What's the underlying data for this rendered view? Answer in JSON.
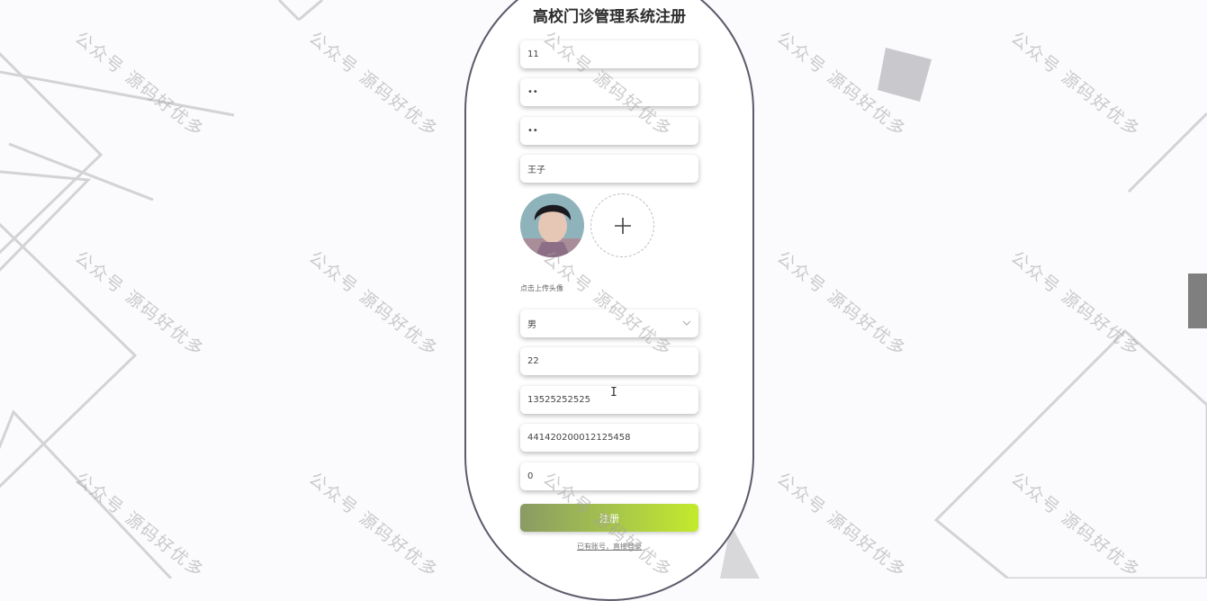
{
  "page": {
    "title": "高校门诊管理系统注册",
    "watermark": "公众号 源码好优多"
  },
  "form": {
    "account": "11",
    "password": "••",
    "confirm_password": "••",
    "name": "王子",
    "upload_hint": "点击上传头像",
    "gender": "男",
    "age": "22",
    "phone": "13525252525",
    "id_card": "441420200012125458",
    "field_last": "0",
    "submit_label": "注册",
    "login_link": "已有账号，直接登录"
  },
  "colors": {
    "accent_start": "#8a9b64",
    "accent_end": "#c4ea2c",
    "card_border": "#5b5b6b"
  },
  "icons": {
    "upload": "plus-icon",
    "dropdown": "chevron-down-icon"
  }
}
